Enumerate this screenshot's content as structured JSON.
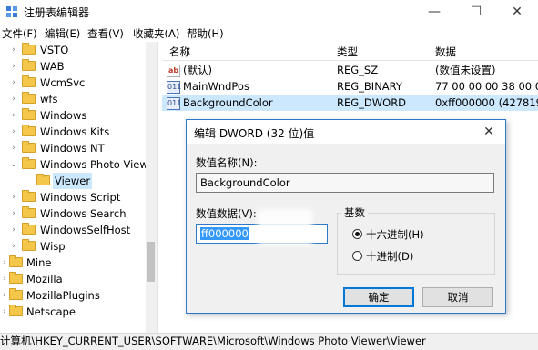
{
  "window": {
    "title": "注册表编辑器",
    "min_icon": "minimize-icon",
    "max_icon": "maximize-icon",
    "close_icon": "close-icon"
  },
  "menu": [
    "文件(F)",
    "编辑(E)",
    "查看(V)",
    "收藏夹(A)",
    "帮助(H)"
  ],
  "tree": {
    "items": [
      {
        "label": "VSTO",
        "expander": "›"
      },
      {
        "label": "WAB",
        "expander": "›"
      },
      {
        "label": "WcmSvc",
        "expander": "›"
      },
      {
        "label": "wfs",
        "expander": "›"
      },
      {
        "label": "Windows",
        "expander": "›"
      },
      {
        "label": "Windows Kits",
        "expander": "›"
      },
      {
        "label": "Windows NT",
        "expander": "›"
      },
      {
        "label": "Windows Photo Viewer",
        "expander": "⌄"
      },
      {
        "label": "Viewer",
        "expander": ""
      },
      {
        "label": "Windows Script",
        "expander": "›"
      },
      {
        "label": "Windows Search",
        "expander": "›"
      },
      {
        "label": "WindowsSelfHost",
        "expander": "›"
      },
      {
        "label": "Wisp",
        "expander": "›"
      },
      {
        "label": "Mine",
        "expander": "›"
      },
      {
        "label": "Mozilla",
        "expander": "›"
      },
      {
        "label": "MozillaPlugins",
        "expander": "›"
      },
      {
        "label": "Netscape",
        "expander": "›"
      }
    ]
  },
  "list": {
    "headers": [
      "名称",
      "类型",
      "数据"
    ],
    "rows": [
      {
        "icon": "string-value-icon",
        "name": "(默认)",
        "type": "REG_SZ",
        "data": "(数值未设置)"
      },
      {
        "icon": "binary-value-icon",
        "name": "MainWndPos",
        "type": "REG_BINARY",
        "data": "77 00 00 00 38 00 00"
      },
      {
        "icon": "binary-value-icon",
        "name": "BackgroundColor",
        "type": "REG_DWORD",
        "data": "0xff000000 (42781900"
      }
    ]
  },
  "dialog": {
    "title": "编辑 DWORD (32 位)值",
    "name_label": "数值名称(N):",
    "name_value": "BackgroundColor",
    "data_label": "数值数据(V):",
    "data_value": "ff000000",
    "base_label": "基数",
    "hex_label": "十六进制(H)",
    "dec_label": "十进制(D)",
    "base_selected": "十六进制(H)",
    "ok_label": "确定",
    "cancel_label": "取消"
  },
  "status": {
    "path": "计算机\\HKEY_CURRENT_USER\\SOFTWARE\\Microsoft\\Windows Photo Viewer\\Viewer"
  }
}
